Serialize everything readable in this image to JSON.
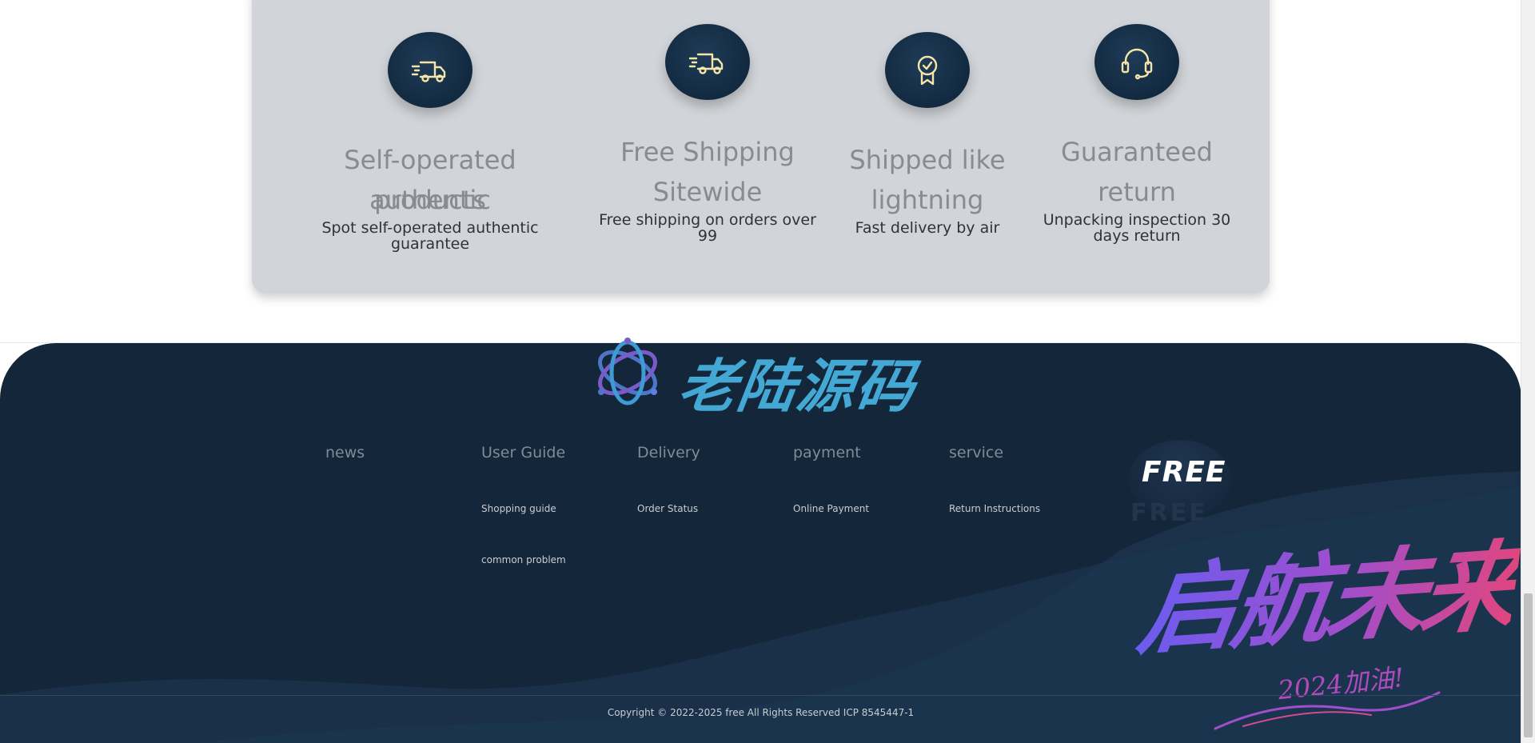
{
  "features": [
    {
      "title_line1": "Self-operated authentic",
      "title_line2": "products",
      "desc_line1": "Spot self-operated authentic guarantee",
      "desc_line2": "",
      "icon": "truck-icon"
    },
    {
      "title_line1": "Free Shipping",
      "title_line2": "Sitewide",
      "desc_line1": "Free shipping on orders over",
      "desc_line2": "99",
      "icon": "truck-icon"
    },
    {
      "title_line1": "Shipped like",
      "title_line2": "lightning",
      "desc_line1": "Fast delivery by air",
      "desc_line2": "",
      "icon": "badge-check-icon"
    },
    {
      "title_line1": "Guaranteed",
      "title_line2": "return",
      "desc_line1": "Unpacking inspection 30",
      "desc_line2": "days return",
      "icon": "headset-icon"
    }
  ],
  "footer": {
    "brand_name": "老陆源码",
    "columns": [
      {
        "title": "news",
        "links": []
      },
      {
        "title": "User Guide",
        "links": [
          "Shopping guide",
          "common problem"
        ]
      },
      {
        "title": "Delivery",
        "links": [
          "Order Status"
        ]
      },
      {
        "title": "payment",
        "links": [
          "Online Payment"
        ]
      },
      {
        "title": "service",
        "links": [
          "Return Instructions"
        ]
      }
    ],
    "badge_text": "FREE",
    "badge_ghost": "FREE",
    "slogan": "启航未来",
    "slogan_sub": "2024加油!",
    "copyright": "Copyright © 2022-2025 free All Rights Reserved ICP 8545447-1"
  },
  "colors": {
    "card_bg": "#d1d4d8",
    "icon_bg": "#122a40",
    "icon_stroke": "#f5e6a8",
    "footer_bg": "#14263a",
    "brand_blue": "#43a8d3"
  }
}
